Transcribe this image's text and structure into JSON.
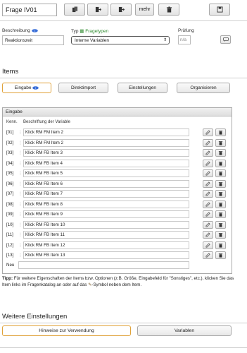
{
  "header": {
    "question_title": "Frage IV01",
    "mehr_label": "mehr"
  },
  "form": {
    "beschreibung_label": "Beschreibung",
    "beschreibung_value": "Reaktionszeit",
    "typ_label": "Typ",
    "fragetypen_link": "Fragetypen",
    "typ_value": "Interne Variablen",
    "pruefung_label": "Prüfung",
    "pruefung_value": "n/a"
  },
  "items_section": {
    "title": "Items",
    "tabs": [
      "Eingabe",
      "Direktimport",
      "Einstellungen",
      "Organisieren"
    ]
  },
  "panel": {
    "title": "Eingabe",
    "col_kenn": "Kenn.",
    "col_label": "Beschriftung der Variable",
    "rows": [
      {
        "id": "[01]",
        "label": "Klick RM FM Item 2"
      },
      {
        "id": "[02]",
        "label": "Klick RM FM Item 2"
      },
      {
        "id": "[03]",
        "label": "Klick RM FB Item 3"
      },
      {
        "id": "[04]",
        "label": "Klick RM FB Item 4"
      },
      {
        "id": "[05]",
        "label": "Klick RM FB Item 5"
      },
      {
        "id": "[06]",
        "label": "Klick RM FB Item 6"
      },
      {
        "id": "[07]",
        "label": "Klick RM FB Item 7"
      },
      {
        "id": "[08]",
        "label": "Klick RM FB Item 8"
      },
      {
        "id": "[09]",
        "label": "Klick RM FB Item 9"
      },
      {
        "id": "[10]",
        "label": "Klick RM FB Item 10"
      },
      {
        "id": "[11]",
        "label": "Klick RM FB Item 11"
      },
      {
        "id": "[12]",
        "label": "Klick RM FB Item 12"
      },
      {
        "id": "[13]",
        "label": "Klick RM FB Item 13"
      }
    ],
    "new_label": "Neu"
  },
  "tip": {
    "bold": "Tipp:",
    "text_before": " Für weitere Eigenschaften der Items bzw. Optionen (z.B. Größe, Eingabefeld für \"Sonstiges\", etc.), klicken Sie das Item links im Fragenkatalog an oder auf das ",
    "text_after": "-Symbol neben dem Item."
  },
  "weitere": {
    "title": "Weitere Einstellungen",
    "btn_hinweise": "Hinweise zur Verwendung",
    "btn_variablen": "Variablen"
  },
  "colors": {
    "accent_orange": "#e0a23a",
    "link_green": "#2e8b2e",
    "info_blue": "#3a6fd8"
  }
}
